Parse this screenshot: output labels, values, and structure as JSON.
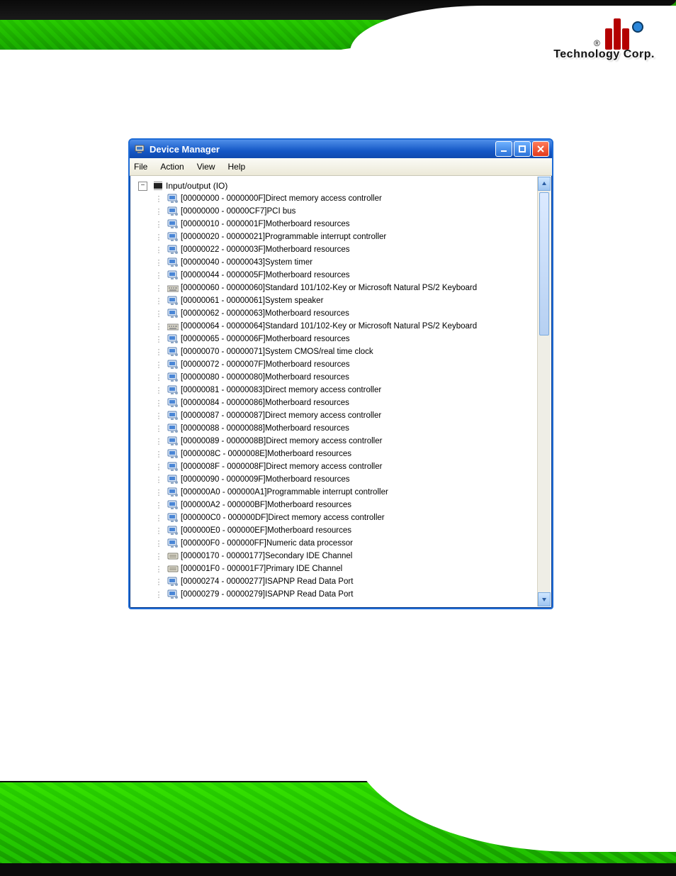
{
  "brand": {
    "r": "®",
    "name": "Technology Corp."
  },
  "window": {
    "title": "Device Manager",
    "menus": [
      "File",
      "Action",
      "View",
      "Help"
    ],
    "root": {
      "expand": "−",
      "label": "Input/output (IO)"
    },
    "rows": [
      {
        "icon": "computer",
        "range": "[00000000 - 0000000F]",
        "label": "Direct memory access controller"
      },
      {
        "icon": "computer",
        "range": "[00000000 - 00000CF7]",
        "label": "PCI bus"
      },
      {
        "icon": "computer",
        "range": "[00000010 - 0000001F]",
        "label": "Motherboard resources"
      },
      {
        "icon": "computer",
        "range": "[00000020 - 00000021]",
        "label": "Programmable interrupt controller"
      },
      {
        "icon": "computer",
        "range": "[00000022 - 0000003F]",
        "label": "Motherboard resources"
      },
      {
        "icon": "computer",
        "range": "[00000040 - 00000043]",
        "label": "System timer"
      },
      {
        "icon": "computer",
        "range": "[00000044 - 0000005F]",
        "label": "Motherboard resources"
      },
      {
        "icon": "keyboard",
        "range": "[00000060 - 00000060]",
        "label": "Standard 101/102-Key or Microsoft Natural PS/2 Keyboard"
      },
      {
        "icon": "computer",
        "range": "[00000061 - 00000061]",
        "label": "System speaker"
      },
      {
        "icon": "computer",
        "range": "[00000062 - 00000063]",
        "label": "Motherboard resources"
      },
      {
        "icon": "keyboard",
        "range": "[00000064 - 00000064]",
        "label": "Standard 101/102-Key or Microsoft Natural PS/2 Keyboard"
      },
      {
        "icon": "computer",
        "range": "[00000065 - 0000006F]",
        "label": "Motherboard resources"
      },
      {
        "icon": "computer",
        "range": "[00000070 - 00000071]",
        "label": "System CMOS/real time clock"
      },
      {
        "icon": "computer",
        "range": "[00000072 - 0000007F]",
        "label": "Motherboard resources"
      },
      {
        "icon": "computer",
        "range": "[00000080 - 00000080]",
        "label": "Motherboard resources"
      },
      {
        "icon": "computer",
        "range": "[00000081 - 00000083]",
        "label": "Direct memory access controller"
      },
      {
        "icon": "computer",
        "range": "[00000084 - 00000086]",
        "label": "Motherboard resources"
      },
      {
        "icon": "computer",
        "range": "[00000087 - 00000087]",
        "label": "Direct memory access controller"
      },
      {
        "icon": "computer",
        "range": "[00000088 - 00000088]",
        "label": "Motherboard resources"
      },
      {
        "icon": "computer",
        "range": "[00000089 - 0000008B]",
        "label": "Direct memory access controller"
      },
      {
        "icon": "computer",
        "range": "[0000008C - 0000008E]",
        "label": "Motherboard resources"
      },
      {
        "icon": "computer",
        "range": "[0000008F - 0000008F]",
        "label": "Direct memory access controller"
      },
      {
        "icon": "computer",
        "range": "[00000090 - 0000009F]",
        "label": "Motherboard resources"
      },
      {
        "icon": "computer",
        "range": "[000000A0 - 000000A1]",
        "label": "Programmable interrupt controller"
      },
      {
        "icon": "computer",
        "range": "[000000A2 - 000000BF]",
        "label": "Motherboard resources"
      },
      {
        "icon": "computer",
        "range": "[000000C0 - 000000DF]",
        "label": "Direct memory access controller"
      },
      {
        "icon": "computer",
        "range": "[000000E0 - 000000EF]",
        "label": "Motherboard resources"
      },
      {
        "icon": "computer",
        "range": "[000000F0 - 000000FF]",
        "label": "Numeric data processor"
      },
      {
        "icon": "ide",
        "range": "[00000170 - 00000177]",
        "label": "Secondary IDE Channel"
      },
      {
        "icon": "ide",
        "range": "[000001F0 - 000001F7]",
        "label": "Primary IDE Channel"
      },
      {
        "icon": "computer",
        "range": "[00000274 - 00000277]",
        "label": "ISAPNP Read Data Port"
      },
      {
        "icon": "computer",
        "range": "[00000279 - 00000279]",
        "label": "ISAPNP Read Data Port"
      }
    ]
  }
}
